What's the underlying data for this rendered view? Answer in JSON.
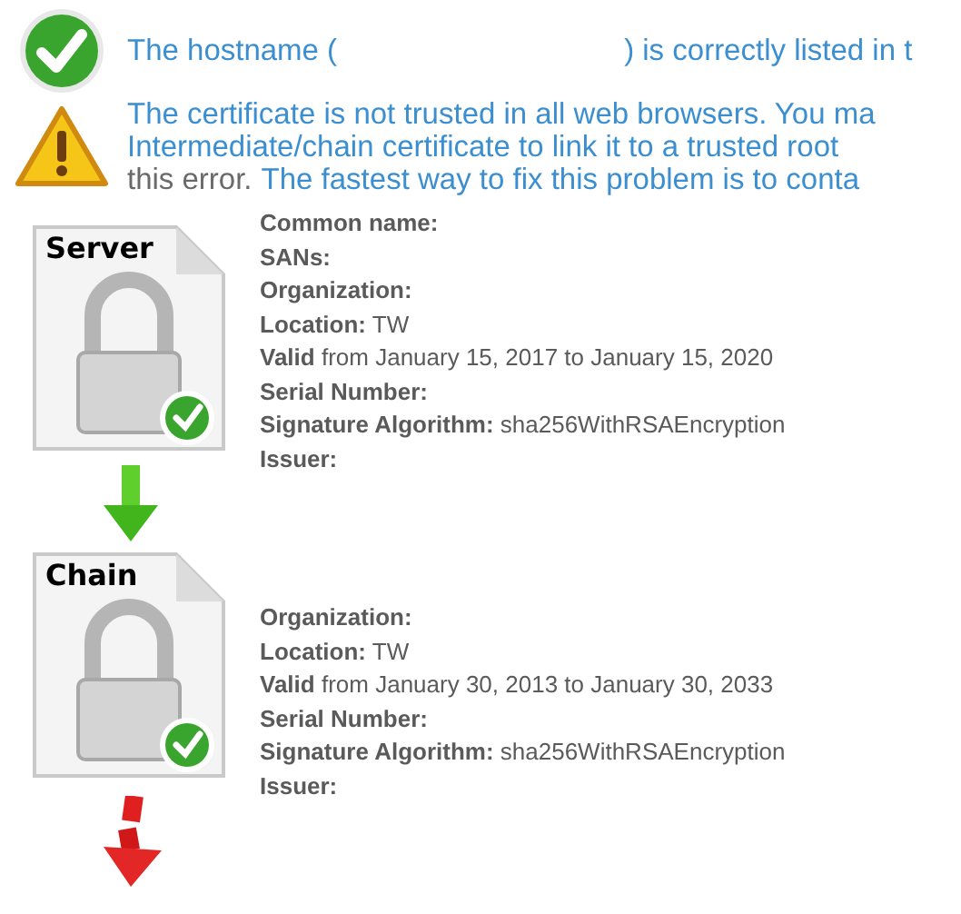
{
  "messages": [
    {
      "kind": "ok",
      "lines": [
        [
          {
            "text": "The hostname (",
            "color": "#3b8fd0"
          },
          {
            "text": ") is correctly listed in t",
            "color": "#3b8fd0",
            "gap": true
          }
        ]
      ]
    },
    {
      "kind": "warning",
      "lines": [
        [
          {
            "text": "The certificate is not trusted in all web browsers. You ma",
            "color": "#3b8fd0"
          }
        ],
        [
          {
            "text": "Intermediate/chain certificate to link it to a trusted root",
            "color": "#3b8fd0"
          }
        ],
        [
          {
            "text": "this error.",
            "color": "#6a6a6a"
          },
          {
            "text": "The fastest way to fix this problem is to conta",
            "color": "#3b8fd0"
          }
        ]
      ]
    }
  ],
  "chain": [
    {
      "kind": "certificate",
      "label": "Server",
      "valid": true,
      "fields": [
        {
          "label": "Common name:"
        },
        {
          "label": "SANs:"
        },
        {
          "label": "Organization:"
        },
        {
          "label": "Location:",
          "value": "TW"
        },
        {
          "label": "Valid",
          "value": "from January 15, 2017 to January 15, 2020"
        },
        {
          "label": "Serial Number:"
        },
        {
          "label": "Signature Algorithm:",
          "value": "sha256WithRSAEncryption"
        },
        {
          "label": "Issuer:"
        }
      ]
    },
    {
      "kind": "link",
      "broken": false
    },
    {
      "kind": "certificate",
      "label": "Chain",
      "valid": true,
      "fields": [
        {
          "label": "Organization:"
        },
        {
          "label": "Location:",
          "value": "TW"
        },
        {
          "label": "Valid",
          "value": "from January 30, 2013 to January 30, 2033"
        },
        {
          "label": "Serial Number:"
        },
        {
          "label": "Signature Algorithm:",
          "value": "sha256WithRSAEncryption"
        },
        {
          "label": "Issuer:"
        }
      ]
    },
    {
      "kind": "link",
      "broken": true
    }
  ]
}
